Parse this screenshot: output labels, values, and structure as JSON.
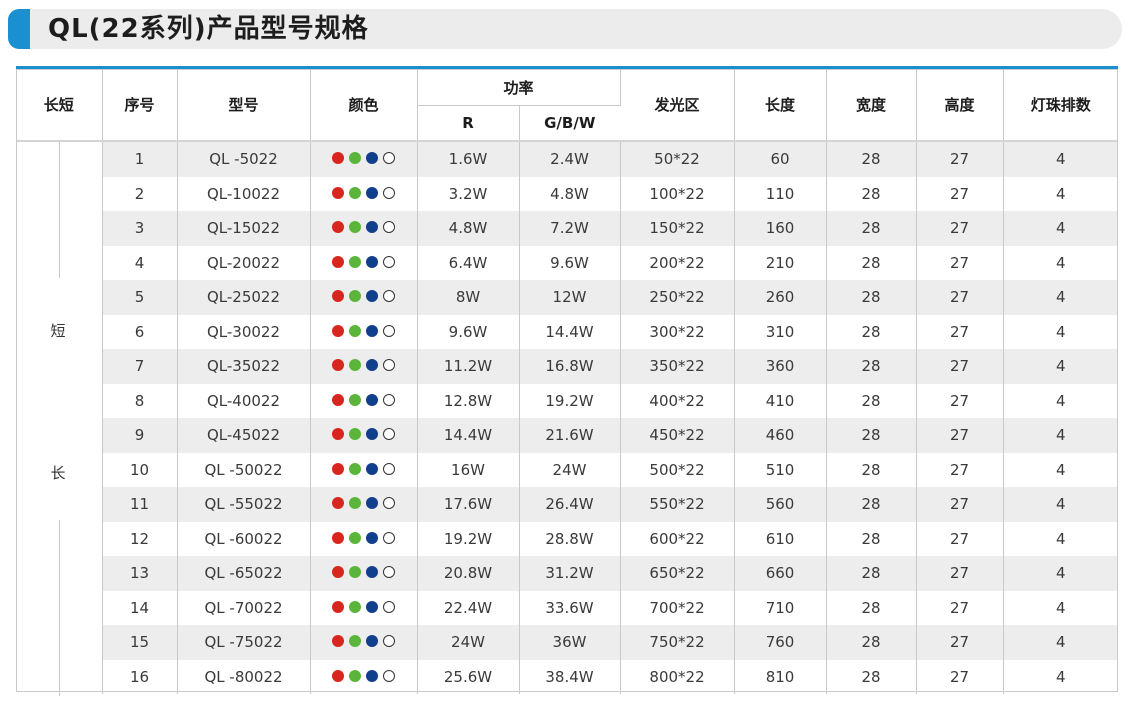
{
  "title": "QL(22系列)产品型号规格",
  "colors": {
    "accent": "#1a90d0",
    "red": "#d7261e",
    "green": "#5bb53b",
    "blue": "#123f8c",
    "white": "#ffffff"
  },
  "headers": {
    "length": "长短",
    "index": "序号",
    "model": "型号",
    "color": "颜色",
    "power": "功率",
    "power_r": "R",
    "power_gbw": "G/B/W",
    "emitting_area": "发光区",
    "length_mm": "长度",
    "width": "宽度",
    "height": "高度",
    "led_rows": "灯珠排数"
  },
  "group_labels": [
    "短",
    "长"
  ],
  "dot_icons": [
    "red-dot-icon",
    "green-dot-icon",
    "blue-dot-icon",
    "white-dot-icon"
  ],
  "rows": [
    {
      "no": "1",
      "model": "QL -5022",
      "r": "1.6W",
      "gbw": "2.4W",
      "area": "50*22",
      "length": "60",
      "width": "28",
      "height": "27",
      "rows": "4"
    },
    {
      "no": "2",
      "model": "QL-10022",
      "r": "3.2W",
      "gbw": "4.8W",
      "area": "100*22",
      "length": "110",
      "width": "28",
      "height": "27",
      "rows": "4"
    },
    {
      "no": "3",
      "model": "QL-15022",
      "r": "4.8W",
      "gbw": "7.2W",
      "area": "150*22",
      "length": "160",
      "width": "28",
      "height": "27",
      "rows": "4"
    },
    {
      "no": "4",
      "model": "QL-20022",
      "r": "6.4W",
      "gbw": "9.6W",
      "area": "200*22",
      "length": "210",
      "width": "28",
      "height": "27",
      "rows": "4"
    },
    {
      "no": "5",
      "model": "QL-25022",
      "r": "8W",
      "gbw": "12W",
      "area": "250*22",
      "length": "260",
      "width": "28",
      "height": "27",
      "rows": "4"
    },
    {
      "no": "6",
      "model": "QL-30022",
      "r": "9.6W",
      "gbw": "14.4W",
      "area": "300*22",
      "length": "310",
      "width": "28",
      "height": "27",
      "rows": "4"
    },
    {
      "no": "7",
      "model": "QL-35022",
      "r": "11.2W",
      "gbw": "16.8W",
      "area": "350*22",
      "length": "360",
      "width": "28",
      "height": "27",
      "rows": "4"
    },
    {
      "no": "8",
      "model": "QL-40022",
      "r": "12.8W",
      "gbw": "19.2W",
      "area": "400*22",
      "length": "410",
      "width": "28",
      "height": "27",
      "rows": "4"
    },
    {
      "no": "9",
      "model": "QL-45022",
      "r": "14.4W",
      "gbw": "21.6W",
      "area": "450*22",
      "length": "460",
      "width": "28",
      "height": "27",
      "rows": "4"
    },
    {
      "no": "10",
      "model": "QL -50022",
      "r": "16W",
      "gbw": "24W",
      "area": "500*22",
      "length": "510",
      "width": "28",
      "height": "27",
      "rows": "4"
    },
    {
      "no": "11",
      "model": "QL -55022",
      "r": "17.6W",
      "gbw": "26.4W",
      "area": "550*22",
      "length": "560",
      "width": "28",
      "height": "27",
      "rows": "4"
    },
    {
      "no": "12",
      "model": "QL -60022",
      "r": "19.2W",
      "gbw": "28.8W",
      "area": "600*22",
      "length": "610",
      "width": "28",
      "height": "27",
      "rows": "4"
    },
    {
      "no": "13",
      "model": "QL -65022",
      "r": "20.8W",
      "gbw": "31.2W",
      "area": "650*22",
      "length": "660",
      "width": "28",
      "height": "27",
      "rows": "4"
    },
    {
      "no": "14",
      "model": "QL -70022",
      "r": "22.4W",
      "gbw": "33.6W",
      "area": "700*22",
      "length": "710",
      "width": "28",
      "height": "27",
      "rows": "4"
    },
    {
      "no": "15",
      "model": "QL -75022",
      "r": "24W",
      "gbw": "36W",
      "area": "750*22",
      "length": "760",
      "width": "28",
      "height": "27",
      "rows": "4"
    },
    {
      "no": "16",
      "model": "QL -80022",
      "r": "25.6W",
      "gbw": "38.4W",
      "area": "800*22",
      "length": "810",
      "width": "28",
      "height": "27",
      "rows": "4"
    }
  ]
}
